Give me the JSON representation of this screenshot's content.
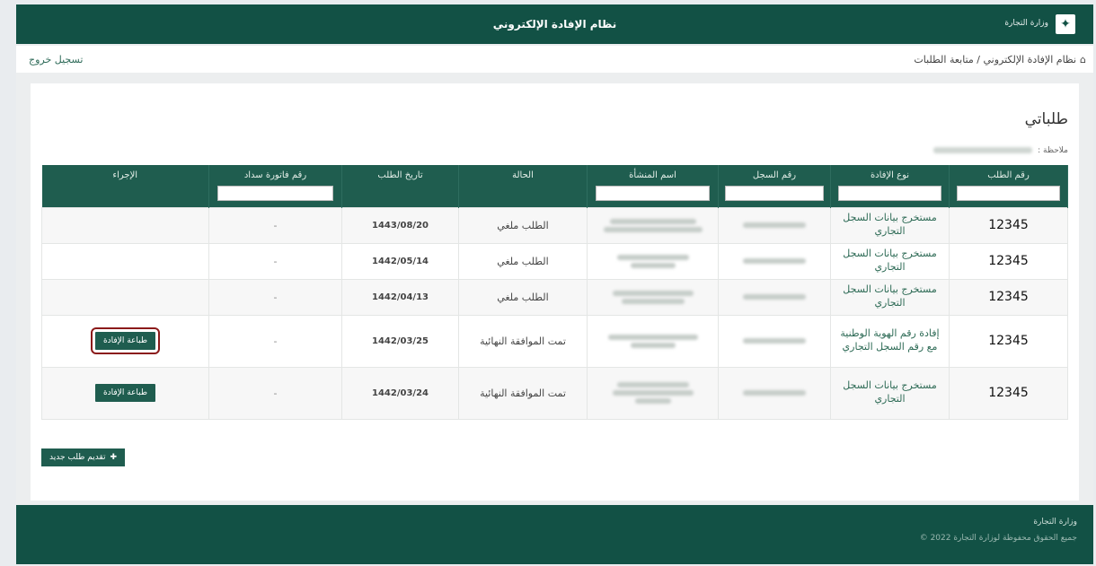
{
  "header": {
    "system_title": "نظام الإفادة الإلكتروني",
    "brand_icon": "ministry-emblem",
    "brand_text": "وزارة التجارة"
  },
  "breadcrumb": {
    "home_icon": "home-icon",
    "path": "نظام الإفادة الإلكتروني / متابعة الطلبات",
    "logout": "تسجيل خروج"
  },
  "page": {
    "title": "طلباتي",
    "hint_prefix": "ملاحظة :"
  },
  "table": {
    "columns": [
      "رقم الطلب",
      "نوع الإفادة",
      "رقم السجل",
      "اسم المنشأة",
      "الحالة",
      "تاريخ الطلب",
      "رقم فاتورة سداد",
      "الإجراء"
    ],
    "rows": [
      {
        "id": "12345",
        "type": "مستخرج بيانات السجل التجاري",
        "status": "الطلب ملغي",
        "date": "1443/08/20",
        "invoice": "-",
        "action": ""
      },
      {
        "id": "12345",
        "type": "مستخرج بيانات السجل التجاري",
        "status": "الطلب ملغي",
        "date": "1442/05/14",
        "invoice": "-",
        "action": ""
      },
      {
        "id": "12345",
        "type": "مستخرج بيانات السجل التجاري",
        "status": "الطلب ملغي",
        "date": "1442/04/13",
        "invoice": "-",
        "action": ""
      },
      {
        "id": "12345",
        "type": "إفادة رقم الهوية الوطنية مع رقم السجل التجاري",
        "status": "تمت الموافقة النهائية",
        "date": "1442/03/25",
        "invoice": "-",
        "action": "طباعة الإفادة"
      },
      {
        "id": "12345",
        "type": "مستخرج بيانات السجل التجاري",
        "status": "تمت الموافقة النهائية",
        "date": "1442/03/24",
        "invoice": "-",
        "action": "طباعة الإفادة"
      }
    ]
  },
  "new_request_button": "تقديم طلب جديد",
  "footer": {
    "line1": "وزارة التجارة",
    "line2": "جميع الحقوق محفوظة لوزارة التجارة 2022 ©"
  },
  "colors": {
    "primary": "#125145",
    "table_header": "#1f5d4f",
    "highlight_outline": "#8b1a1a"
  }
}
